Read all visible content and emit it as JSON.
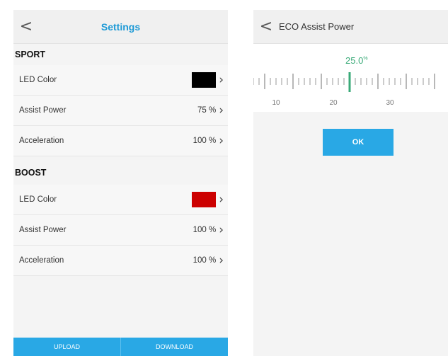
{
  "settings_screen": {
    "back_glyph": "<",
    "title": "Settings",
    "sport": {
      "heading": "SPORT",
      "led_label": "LED Color",
      "led_color": "#000000",
      "assist_label": "Assist Power",
      "assist_value": "75 %",
      "accel_label": "Acceleration",
      "accel_value": "100 %"
    },
    "boost": {
      "heading": "BOOST",
      "led_label": "LED Color",
      "led_color": "#cc0000",
      "assist_label": "Assist Power",
      "assist_value": "100 %",
      "accel_label": "Acceleration",
      "accel_value": "100 %"
    },
    "upload_label": "UPLOAD",
    "download_label": "DOWNLOAD",
    "chevron_icon": "chevron-right-icon"
  },
  "eco_screen": {
    "back_glyph": "<",
    "title": "ECO Assist Power",
    "current_value": "25.0",
    "unit_mark": "%",
    "ruler": {
      "min_visible": 8,
      "max_visible": 40,
      "selected": 25,
      "labels": [
        "10",
        "20",
        "30"
      ]
    },
    "ok_label": "OK"
  },
  "colors": {
    "accent": "#29a8e5",
    "title_blue": "#1e9ad6",
    "value_green": "#3aaa78"
  }
}
